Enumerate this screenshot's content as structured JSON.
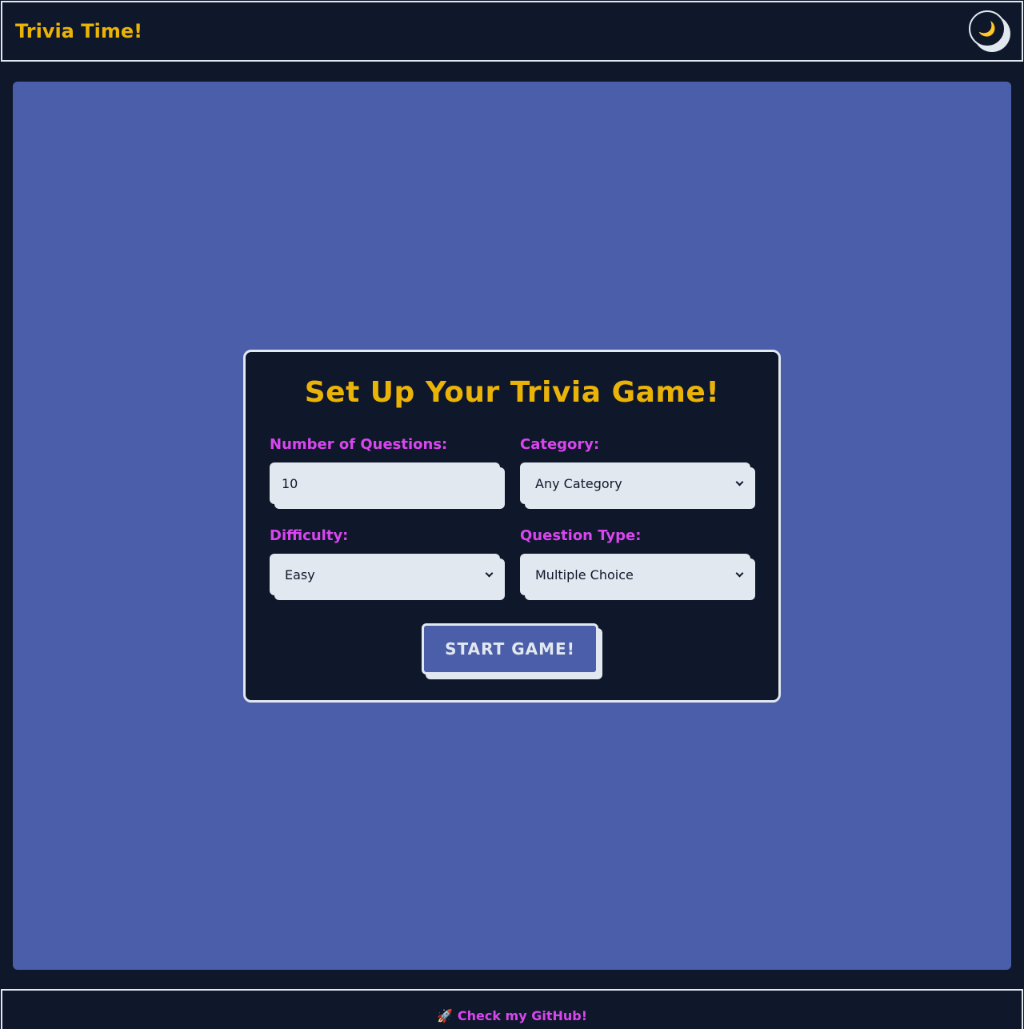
{
  "header": {
    "title": "Trivia Time!",
    "theme_toggle_icon": "🌙"
  },
  "setup": {
    "title": "Set Up Your Trivia Game!",
    "fields": {
      "questions": {
        "label": "Number of Questions:",
        "value": "10"
      },
      "category": {
        "label": "Category:",
        "value": "Any Category"
      },
      "difficulty": {
        "label": "Difficulty:",
        "value": "Easy"
      },
      "type": {
        "label": "Question Type:",
        "value": "Multiple Choice"
      }
    },
    "start_label": "START GAME!"
  },
  "footer": {
    "icon": "🚀",
    "link_label": "Check my GitHub!"
  },
  "colors": {
    "background": "#0f172a",
    "main": "#4b5ea9",
    "accent_yellow": "#eab308",
    "accent_magenta": "#d946ef",
    "light": "#e2e8f0"
  }
}
